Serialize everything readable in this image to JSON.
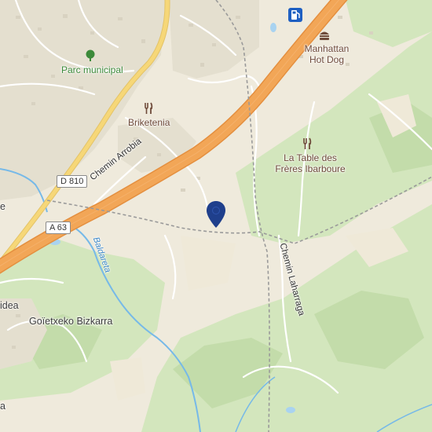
{
  "map": {
    "labels": {
      "parc": "Parc municipal",
      "manhattan_line1": "Manhattan",
      "manhattan_line2": "Hot Dog",
      "briketenia": "Briketenia",
      "table_line1": "La Table des",
      "table_line2": "Frères Ibarboure",
      "chemin_arrobia": "Chemin Arrobia",
      "chemin_laharraga": "Chemin Laharraga",
      "baldareta": "Baldareta",
      "goietxeko": "Goïetxeko Bizkarra",
      "idea_fragment": "idea",
      "edge_e": "e",
      "edge_a": "a"
    },
    "road_shields": {
      "d810": "D 810",
      "a63": "A 63"
    },
    "icons": {
      "park": "tree-icon",
      "fuel": "fuel-pump-icon",
      "fastfood": "burger-icon",
      "restaurant1": "fork-knife-icon",
      "restaurant2": "fork-knife-icon",
      "marker": "location-pin-icon"
    },
    "colors": {
      "background": "#efeadc",
      "motorway": "#f2a657",
      "primary_road": "#f6d778",
      "water": "#76b9e8",
      "vegetation": "#cfe4b8",
      "pin": "#1f3f8c",
      "poi_label": "#6e4a3a",
      "park_label": "#3c8a3a"
    }
  }
}
